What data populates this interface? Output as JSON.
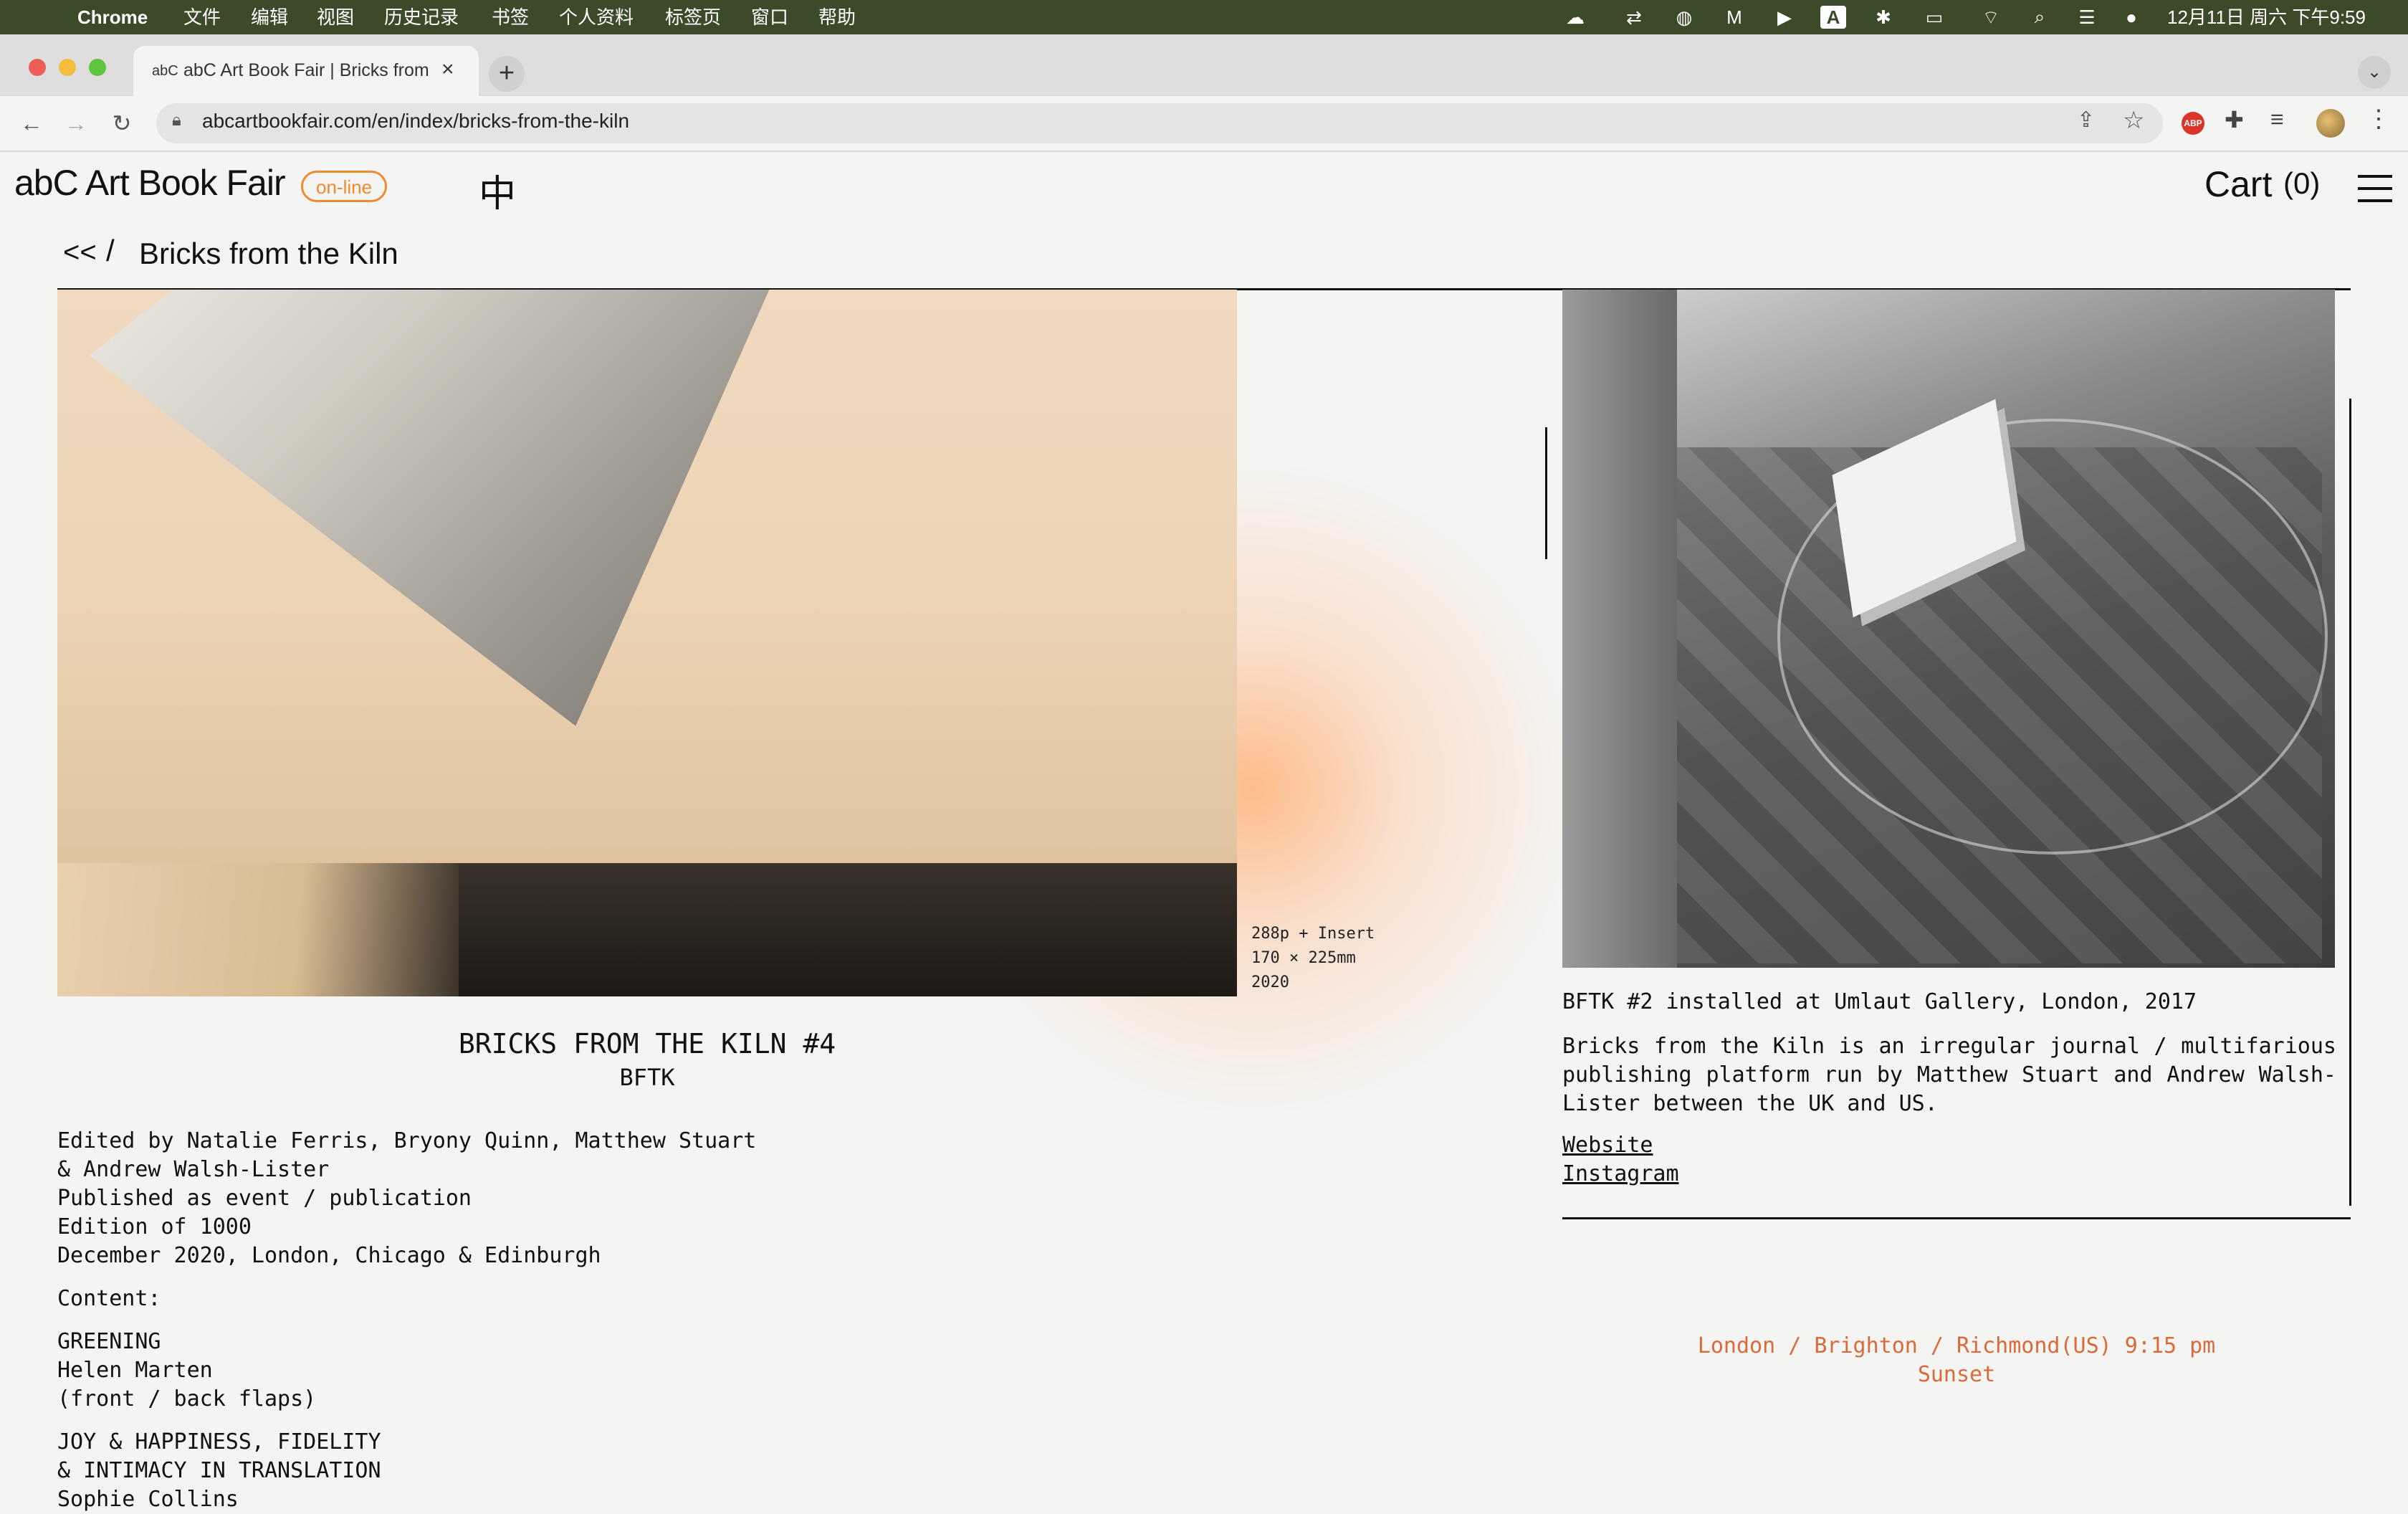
{
  "menubar": {
    "app_name": "Chrome",
    "items": [
      "文件",
      "编辑",
      "视图",
      "历史记录",
      "书签",
      "个人资料",
      "标签页",
      "窗口",
      "帮助"
    ],
    "clock": "12月11日 周六 下午9:59"
  },
  "browser": {
    "tab_title": "abC Art Book Fair | Bricks from",
    "tab_favicon": "abC",
    "url": "abcartbookfair.com/en/index/bricks-from-the-kiln",
    "abp_label": "ABP"
  },
  "site": {
    "logo": "abC Art Book Fair",
    "badge": "on-line",
    "lang_toggle": "中",
    "cart_label": "Cart",
    "cart_count": "(0)"
  },
  "breadcrumb": {
    "back": "<<",
    "separator": "/",
    "title": "Bricks from the Kiln"
  },
  "book": {
    "specs": [
      "288p + Insert",
      "170 × 225mm",
      "2020"
    ],
    "title": "BRICKS FROM THE KILN #4",
    "subtitle": "BFTK",
    "credits": [
      "Edited by Natalie Ferris, Bryony Quinn, Matthew Stuart",
      "& Andrew Walsh-Lister",
      "Published as event / publication",
      "Edition of 1000",
      "December 2020, London, Chicago & Edinburgh"
    ],
    "content_label": "Content:",
    "content_items": [
      [
        "GREENING",
        "Helen Marten",
        "(front / back flaps)"
      ],
      [
        "JOY & HAPPINESS, FIDELITY",
        "& INTIMACY IN TRANSLATION",
        "Sophie Collins"
      ]
    ]
  },
  "publisher": {
    "caption": "BFTK #2 installed at Umlaut Gallery, London, 2017",
    "description": "Bricks from the Kiln is an irregular journal / multifarious pub­lishing platform run by Matthew Stuart and Andrew Walsh-Lister be­tween the UK and US.",
    "website": "Website",
    "instagram": "Instagram"
  },
  "sunset": {
    "time": "London / Brighton / Richmond(US) 9:15 pm",
    "label": "Sunset"
  },
  "colors": {
    "accent": "#ef8a2e",
    "sunset_text": "#d96b3a"
  }
}
